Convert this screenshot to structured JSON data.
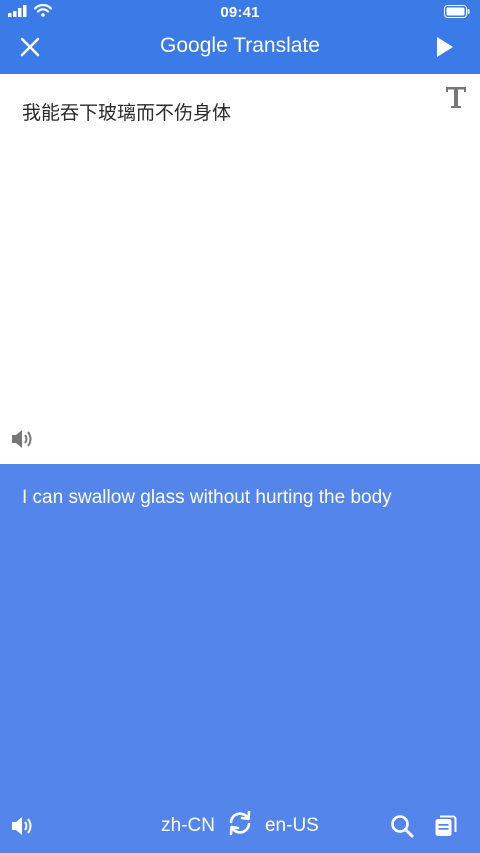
{
  "status_bar": {
    "time": "09:41",
    "icons": [
      "cellular-signal-icon",
      "wifi-icon",
      "battery-icon"
    ]
  },
  "header": {
    "title": "Google Translate",
    "icons": [
      "close-icon",
      "play-icon"
    ]
  },
  "source": {
    "text": "我能吞下玻璃而不伤身体",
    "icons": [
      "font-style-icon",
      "speaker-icon"
    ]
  },
  "translation": {
    "text": "I can swallow glass without hurting the body",
    "icons": [
      "speaker-icon",
      "swap-languages-icon",
      "search-icon",
      "cards-icon"
    ]
  },
  "languages": {
    "source": "zh-CN",
    "target": "en-US"
  },
  "colors": {
    "header_blue": "#3a7be8",
    "translation_blue": "#5385ea",
    "source_text": "#2b2b2b",
    "white": "#ffffff",
    "icon_gray": "#777777"
  }
}
